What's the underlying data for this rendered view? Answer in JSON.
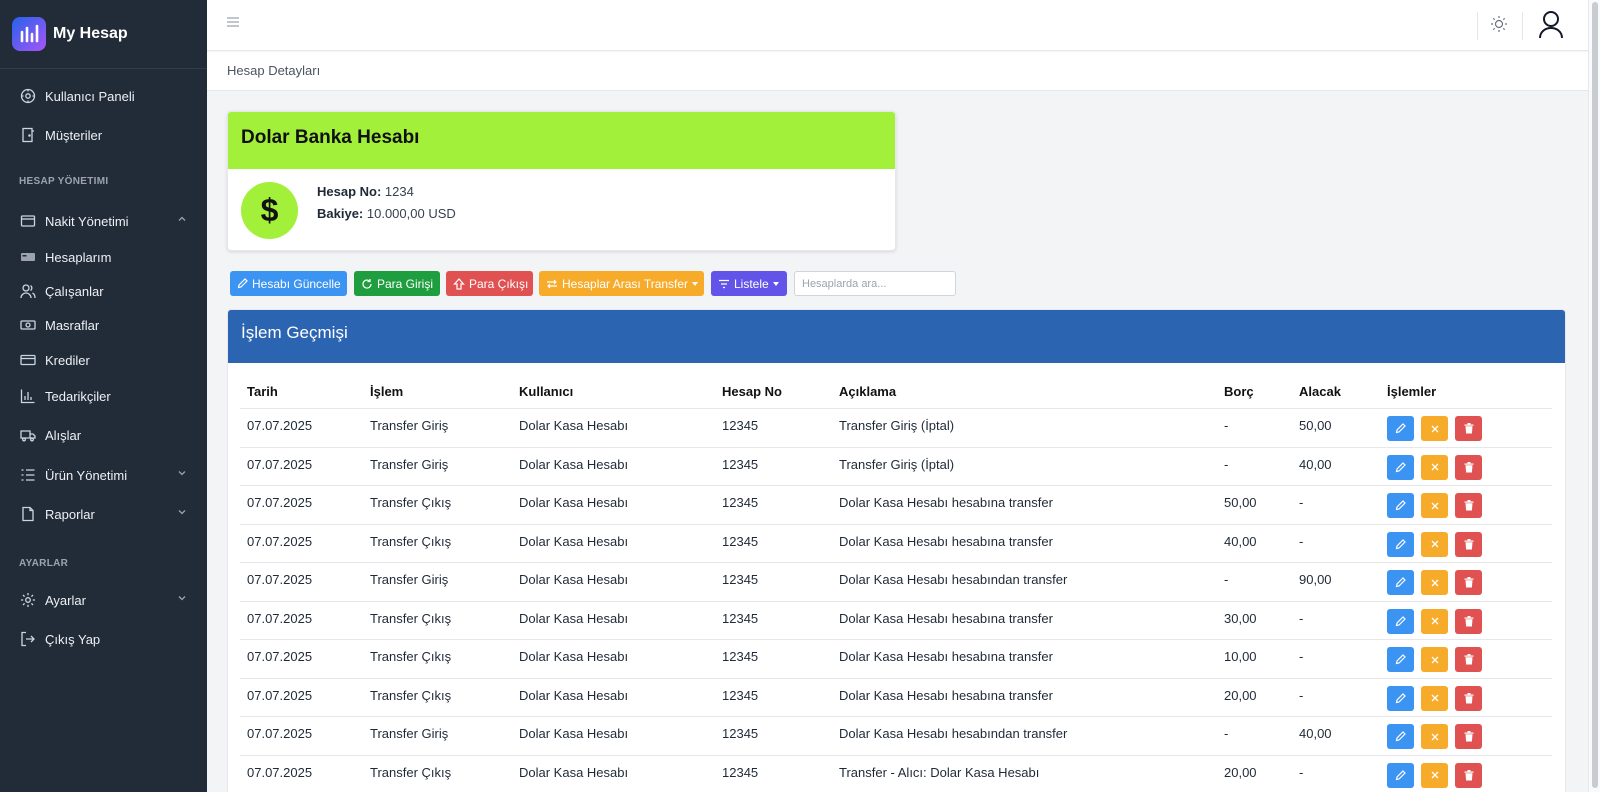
{
  "app": {
    "name": "My Hesap"
  },
  "sidebar": {
    "items": [
      {
        "label": "Kullanıcı Paneli",
        "icon": "dashboard-icon"
      },
      {
        "label": "Müşteriler",
        "icon": "door-icon"
      },
      {
        "section": "HESAP YÖNETIMI"
      },
      {
        "label": "Nakit Yönetimi",
        "icon": "wallet-icon",
        "expanded": true
      },
      {
        "label": "Hesaplarım",
        "icon": "card-icon"
      },
      {
        "label": "Çalışanlar",
        "icon": "users-icon"
      },
      {
        "label": "Masraflar",
        "icon": "money-icon"
      },
      {
        "label": "Krediler",
        "icon": "credit-card-icon"
      },
      {
        "label": "Tedarikçiler",
        "icon": "bar-chart-icon"
      },
      {
        "label": "Alışlar",
        "icon": "truck-icon"
      },
      {
        "label": "Ürün Yönetimi",
        "icon": "list-icon",
        "expanded": false
      },
      {
        "label": "Raporlar",
        "icon": "file-icon",
        "expanded": false
      },
      {
        "section": "AYARLAR"
      },
      {
        "label": "Ayarlar",
        "icon": "gear-icon",
        "expanded": false
      },
      {
        "label": "Çıkış Yap",
        "icon": "logout-icon"
      }
    ]
  },
  "breadcrumb": "Hesap Detayları",
  "account": {
    "name": "Dolar Banka Hesabı",
    "symbol": "$",
    "no_label": "Hesap No:",
    "no": "1234",
    "balance_label": "Bakiye:",
    "balance": "10.000,00 USD"
  },
  "toolbar": {
    "update": "Hesabı Güncelle",
    "deposit": "Para Girişi",
    "withdraw": "Para Çıkışı",
    "transfer": "Hesaplar Arası Transfer",
    "list": "Listele",
    "search_placeholder": "Hesaplarda ara..."
  },
  "history": {
    "title": "İşlem Geçmişi",
    "columns": [
      "Tarih",
      "İşlem",
      "Kullanıcı",
      "Hesap No",
      "Açıklama",
      "Borç",
      "Alacak",
      "İşlemler"
    ],
    "rows": [
      [
        "07.07.2025",
        "Transfer Giriş",
        "Dolar Kasa Hesabı",
        "12345",
        "Transfer Giriş (İptal)",
        "-",
        "50,00"
      ],
      [
        "07.07.2025",
        "Transfer Giriş",
        "Dolar Kasa Hesabı",
        "12345",
        "Transfer Giriş (İptal)",
        "-",
        "40,00"
      ],
      [
        "07.07.2025",
        "Transfer Çıkış",
        "Dolar Kasa Hesabı",
        "12345",
        "Dolar Kasa Hesabı hesabına transfer",
        "50,00",
        "-"
      ],
      [
        "07.07.2025",
        "Transfer Çıkış",
        "Dolar Kasa Hesabı",
        "12345",
        "Dolar Kasa Hesabı hesabına transfer",
        "40,00",
        "-"
      ],
      [
        "07.07.2025",
        "Transfer Giriş",
        "Dolar Kasa Hesabı",
        "12345",
        "Dolar Kasa Hesabı hesabından transfer",
        "-",
        "90,00"
      ],
      [
        "07.07.2025",
        "Transfer Çıkış",
        "Dolar Kasa Hesabı",
        "12345",
        "Dolar Kasa Hesabı hesabına transfer",
        "30,00",
        "-"
      ],
      [
        "07.07.2025",
        "Transfer Çıkış",
        "Dolar Kasa Hesabı",
        "12345",
        "Dolar Kasa Hesabı hesabına transfer",
        "10,00",
        "-"
      ],
      [
        "07.07.2025",
        "Transfer Çıkış",
        "Dolar Kasa Hesabı",
        "12345",
        "Dolar Kasa Hesabı hesabına transfer",
        "20,00",
        "-"
      ],
      [
        "07.07.2025",
        "Transfer Giriş",
        "Dolar Kasa Hesabı",
        "12345",
        "Dolar Kasa Hesabı hesabından transfer",
        "-",
        "40,00"
      ],
      [
        "07.07.2025",
        "Transfer Çıkış",
        "Dolar Kasa Hesabı",
        "12345",
        "Transfer - Alıcı: Dolar Kasa Hesabı",
        "20,00",
        "-"
      ]
    ]
  },
  "colors": {
    "sidebar": "#222b38",
    "accent_green": "#a3f03a",
    "panel_header": "#2b64b1",
    "btn_blue": "#3b93f2",
    "btn_green": "#1e9e3e",
    "btn_red": "#e05252",
    "btn_orange": "#f7ab2a",
    "btn_purple": "#6254e8"
  }
}
